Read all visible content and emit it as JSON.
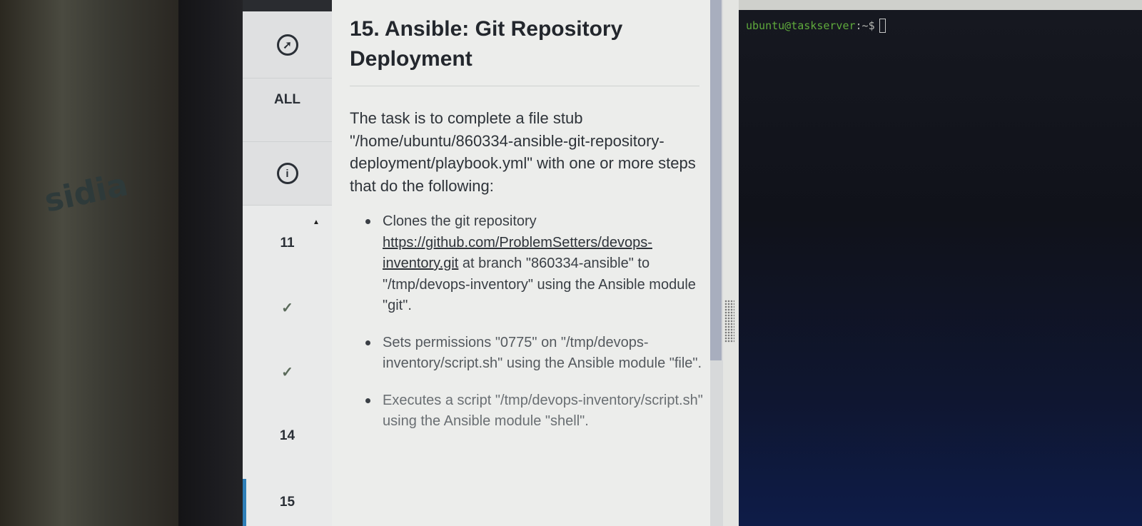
{
  "bottle": {
    "label": "sidia"
  },
  "sidebar": {
    "all_label": "ALL",
    "items": [
      {
        "label": "11",
        "status": "number"
      },
      {
        "label": "✓",
        "status": "completed"
      },
      {
        "label": "✓",
        "status": "completed"
      },
      {
        "label": "14",
        "status": "number"
      },
      {
        "label": "15",
        "status": "active"
      }
    ],
    "icons": [
      "compass-icon",
      "info-icon"
    ]
  },
  "task": {
    "title": "15. Ansible: Git Repository Deployment",
    "description": "The task is to complete a file stub \"/home/ubuntu/860334-ansible-git-repository-deployment/playbook.yml\" with one or more steps that do the following:",
    "steps": [
      {
        "prefix": "Clones the git repository ",
        "link": "https://github.com/ProblemSetters/devops-inventory.git",
        "suffix": " at branch \"860334-ansible\" to \"/tmp/devops-inventory\" using the Ansible module \"git\"."
      },
      {
        "text": "Sets permissions \"0775\" on \"/tmp/devops-inventory/script.sh\" using the Ansible module \"file\"."
      },
      {
        "text": "Executes a script \"/tmp/devops-inventory/script.sh\" using the Ansible module \"shell\"."
      }
    ]
  },
  "terminal": {
    "prompt_user": "ubuntu@taskserver",
    "prompt_suffix": ":~$"
  },
  "colors": {
    "accent": "#2f7fb8",
    "prompt_green": "#5faa3c",
    "terminal_bg": "#10121a"
  }
}
